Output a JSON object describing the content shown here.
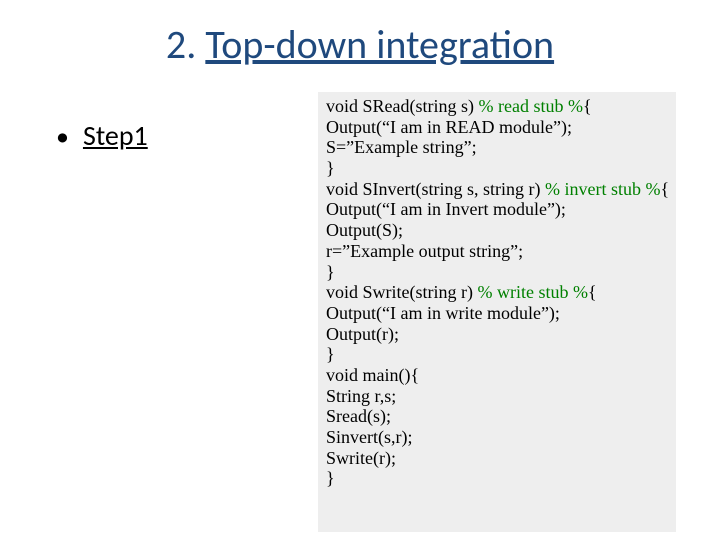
{
  "title": {
    "prefix": "2. ",
    "underlined": "Top-down integration"
  },
  "bullet": {
    "text": "Step1"
  },
  "code": {
    "l1a": "void SRead(string s) ",
    "l1b": "% read stub %",
    "l1c": "{",
    "l2": "Output(“I am in READ module”);",
    "l3": "S=”Example string”;",
    "l4": "}",
    "l5a": "void SInvert(string s, string r) ",
    "l5b": "% invert stub %",
    "l5c": "{",
    "l6": "Output(“I am in Invert module”);",
    "l7": "Output(S);",
    "l8": "r=”Example output string”;",
    "l9": "}",
    "l10a": "void Swrite(string r)  ",
    "l10b": "% write stub %",
    "l10c": "{",
    "l11": "Output(“I am in write module”);",
    "l12": "Output(r);",
    "l13": "}",
    "l14": "void main(){",
    "l15": "String r,s;",
    "l16": "Sread(s);",
    "l17": "Sinvert(s,r);",
    "l18": "Swrite(r);",
    "l19": "}"
  }
}
